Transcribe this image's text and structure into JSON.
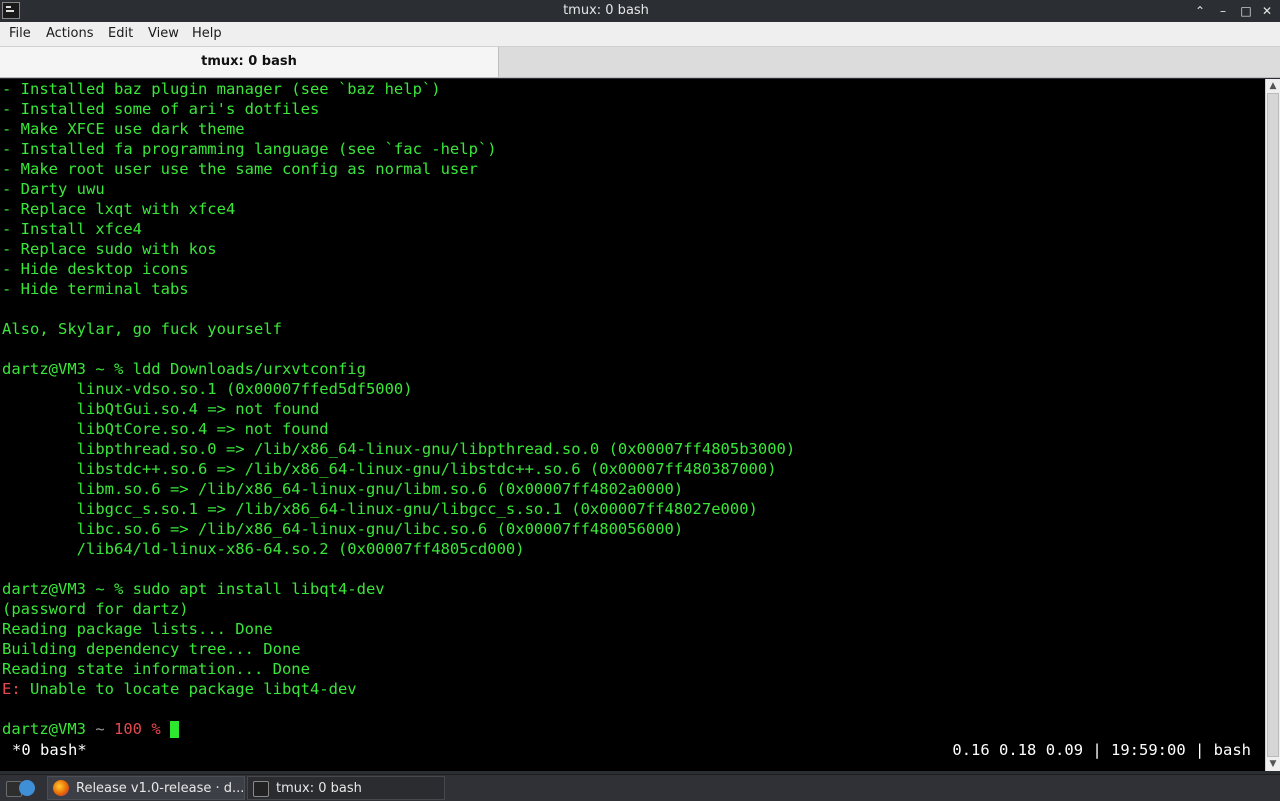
{
  "window": {
    "title": "tmux: 0 bash"
  },
  "menu": [
    "File",
    "Actions",
    "Edit",
    "View",
    "Help"
  ],
  "tab": {
    "label": "tmux: 0 bash"
  },
  "terminal": {
    "lines": [
      "- Installed baz plugin manager (see `baz help`)",
      "- Installed some of ari's dotfiles",
      "- Make XFCE use dark theme",
      "- Installed fa programming language (see `fac -help`)",
      "- Make root user use the same config as normal user",
      "- Darty uwu",
      "- Replace lxqt with xfce4",
      "- Install xfce4",
      "- Replace sudo with kos",
      "- Hide desktop icons",
      "- Hide terminal tabs",
      "",
      "Also, Skylar, go fuck yourself",
      "",
      "dartz@VM3 ~ % ldd Downloads/urxvtconfig",
      "        linux-vdso.so.1 (0x00007ffed5df5000)",
      "        libQtGui.so.4 => not found",
      "        libQtCore.so.4 => not found",
      "        libpthread.so.0 => /lib/x86_64-linux-gnu/libpthread.so.0 (0x00007ff4805b3000)",
      "        libstdc++.so.6 => /lib/x86_64-linux-gnu/libstdc++.so.6 (0x00007ff480387000)",
      "        libm.so.6 => /lib/x86_64-linux-gnu/libm.so.6 (0x00007ff4802a0000)",
      "        libgcc_s.so.1 => /lib/x86_64-linux-gnu/libgcc_s.so.1 (0x00007ff48027e000)",
      "        libc.so.6 => /lib/x86_64-linux-gnu/libc.so.6 (0x00007ff480056000)",
      "        /lib64/ld-linux-x86-64.so.2 (0x00007ff4805cd000)",
      "",
      "dartz@VM3 ~ % sudo apt install libqt4-dev",
      "(password for dartz)",
      "Reading package lists... Done",
      "Building dependency tree... Done",
      "Reading state information... Done"
    ],
    "error_prefix": "E:",
    "error_text": " Unable to locate package libqt4-dev",
    "prompt_user": "dartz@VM3",
    "prompt_tilde": " ~ ",
    "prompt_code": "100 %",
    "colors": {
      "fg": "#3ae63a",
      "error": "#e5484d",
      "tilde": "#9a9a9a",
      "bg": "#000000"
    }
  },
  "tmux_status": {
    "window": "*0 bash*",
    "right": "0.16 0.18 0.09 | 19:59:00 | bash"
  },
  "taskbar": {
    "items": [
      {
        "label": "Release v1.0-release · d...",
        "icon": "firefox-icon"
      },
      {
        "label": "tmux: 0 bash",
        "icon": "terminal-icon"
      }
    ]
  }
}
